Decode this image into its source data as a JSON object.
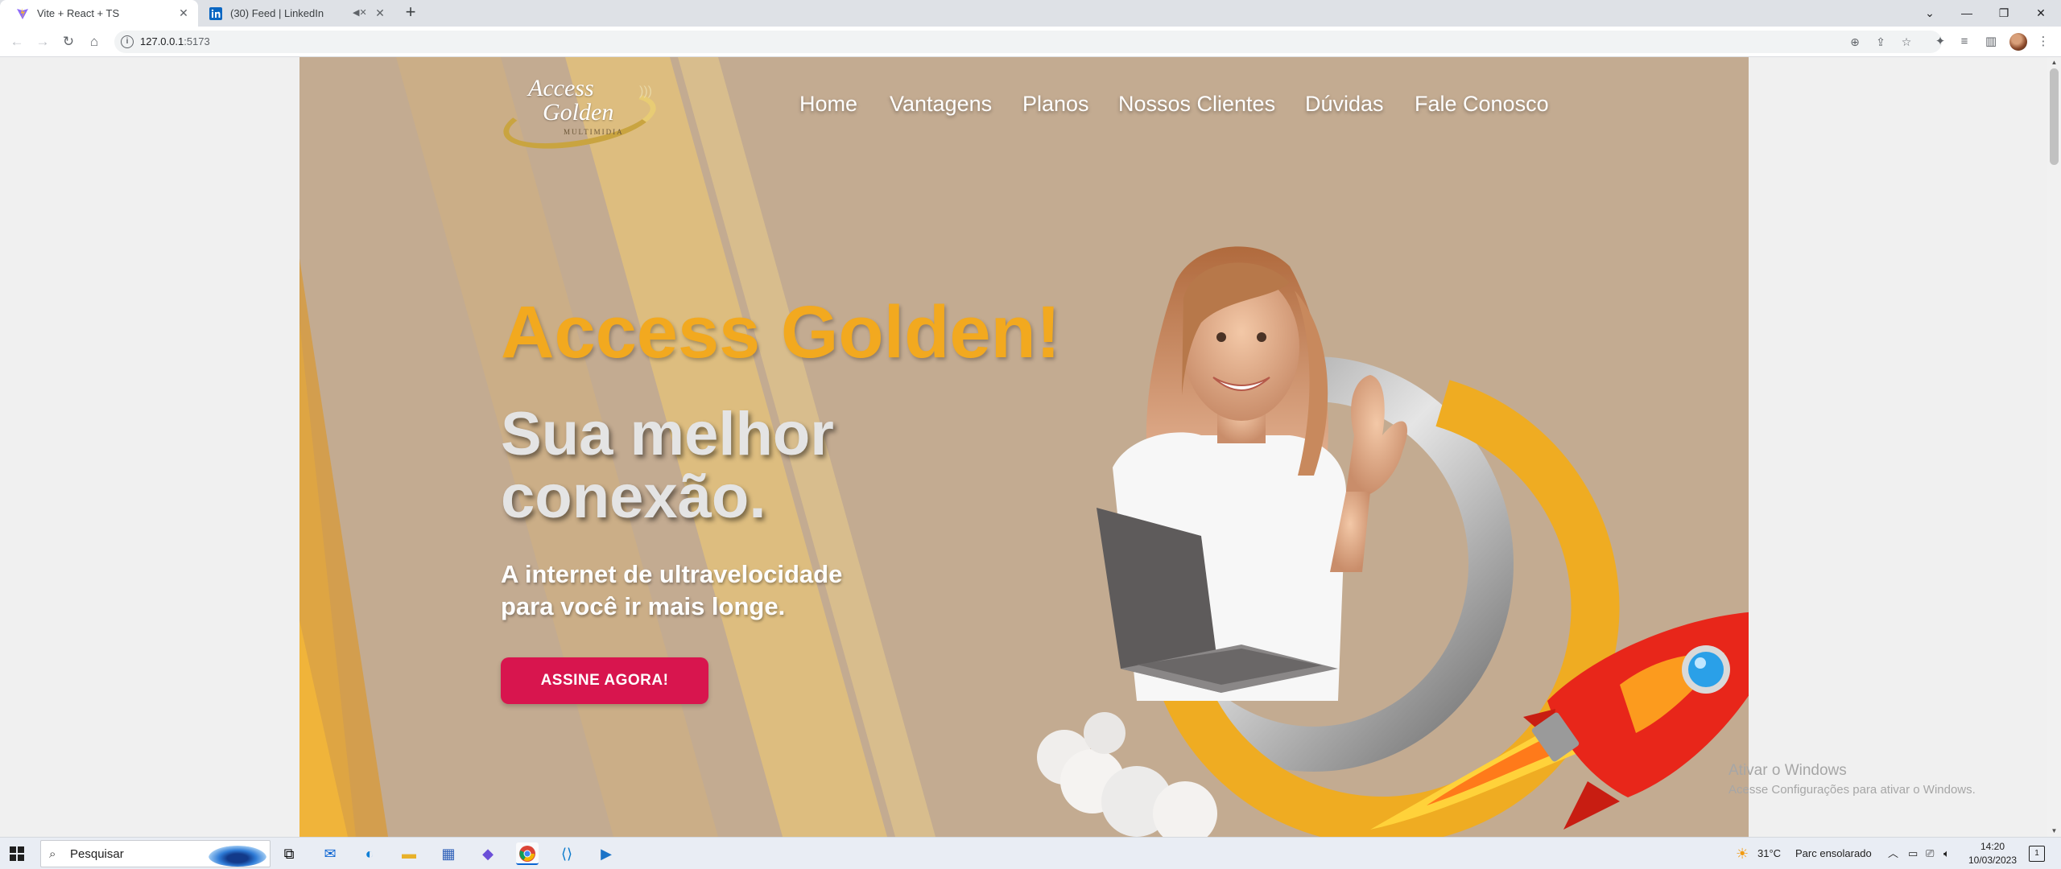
{
  "browser": {
    "tabs": [
      {
        "title": "Vite + React + TS",
        "active": true,
        "icon": "vite-icon"
      },
      {
        "title": "(30) Feed | LinkedIn",
        "active": false,
        "icon": "linkedin-icon",
        "muted": true
      }
    ],
    "url_host": "127.0.0.1",
    "url_port": ":5173"
  },
  "site": {
    "logo": {
      "line1": "Access",
      "line2": "Golden",
      "line3": "MULTIMIDIA"
    },
    "nav": [
      "Home",
      "Vantagens",
      "Planos",
      "Nossos Clientes",
      "Dúvidas",
      "Fale Conosco"
    ],
    "hero": {
      "title": "Access Golden!",
      "subtitle_line1": "Sua melhor",
      "subtitle_line2": "conexão.",
      "desc_line1": "A internet de ultravelocidade",
      "desc_line2": "para você ir mais longe.",
      "cta": "ASSINE AGORA!"
    },
    "colors": {
      "background": "#c3ab91",
      "title": "#f2a91f",
      "cta": "#d8154e"
    }
  },
  "watermark": {
    "line1": "Ativar o Windows",
    "line2": "Acesse Configurações para ativar o Windows."
  },
  "taskbar": {
    "search_placeholder": "Pesquisar",
    "weather_temp": "31°C",
    "weather_desc": "Parc ensolarado",
    "time": "14:20",
    "date": "10/03/2023"
  }
}
